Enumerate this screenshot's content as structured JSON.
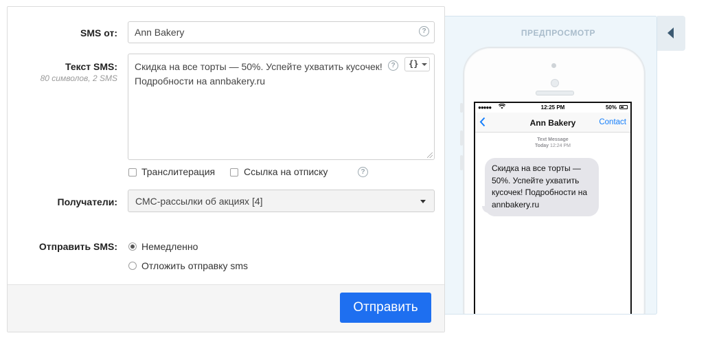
{
  "form": {
    "sender": {
      "label": "SMS от:",
      "value": "Ann Bakery"
    },
    "sms_text": {
      "label": "Текст SMS:",
      "counter": "80 символов, 2 SMS",
      "value_line1": "Скидка на все торты — 50%. Успейте ухватить кусочек!",
      "value_line2": "Подробности на annbakery.ru",
      "variables_button": "{}"
    },
    "options": {
      "transliteration": {
        "label": "Транслитерация",
        "checked": false
      },
      "unsubscribe_link": {
        "label": "Ссылка на отписку",
        "checked": false
      }
    },
    "recipients": {
      "label": "Получатели:",
      "value": "СМС-рассылки об акциях [4]"
    },
    "send_time": {
      "label": "Отправить SMS:",
      "options": [
        {
          "label": "Немедленно",
          "checked": true
        },
        {
          "label": "Отложить отправку sms",
          "checked": false
        }
      ]
    },
    "submit_label": "Отправить"
  },
  "preview": {
    "title": "ПРЕДПРОСМОТР",
    "phone": {
      "signal": "●●●●●",
      "time": "12:25 PM",
      "battery": "50%",
      "battery_level": 0.5,
      "contact_name": "Ann Bakery",
      "contact_button": "Contact",
      "meta_line1": "Text Message",
      "meta_day": "Today",
      "meta_time": "12:24 PM",
      "message": "Скидка на все торты — 50%. Успейте ухватить кусочек! Подробности на annbakery.ru"
    }
  },
  "colors": {
    "primary_button": "#1e6ff0",
    "ios_blue": "#147efb",
    "preview_bg": "#eef6fb"
  }
}
